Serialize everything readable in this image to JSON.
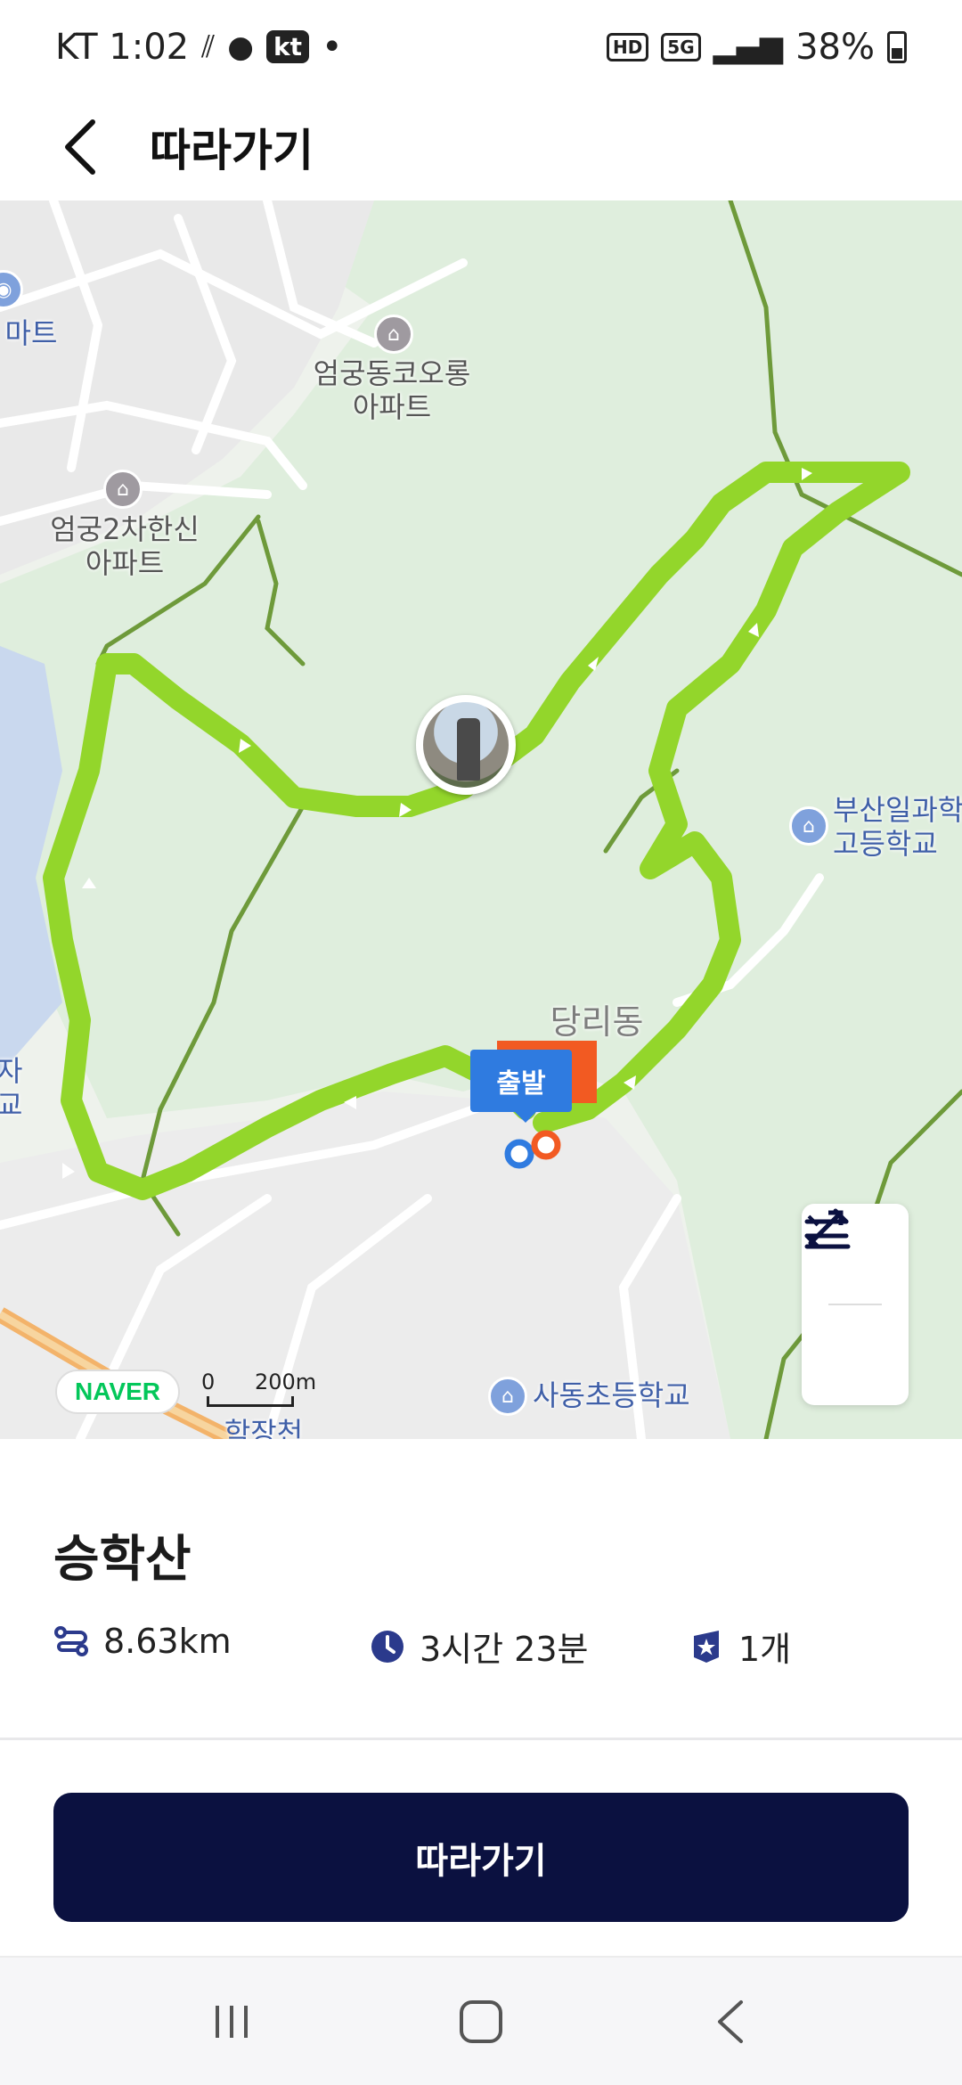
{
  "status_bar": {
    "carrier_time": "KT 1:02",
    "carrier_badge": "kt",
    "dot": "•",
    "hd_badge": "HD",
    "network_badge": "5G",
    "battery_text": "38%"
  },
  "header": {
    "title": "따라가기",
    "back_icon": "chevron-left-icon"
  },
  "map": {
    "labels": {
      "apt1": "엄궁동코오롱\n아파트",
      "apt2": "엄궁2차한신\n아파트",
      "mart": "마트",
      "school_high": "부산일과학\n고등학교",
      "dong": "당리동",
      "school_elem": "사동초등학교",
      "left_edge_1": "자",
      "left_edge_2": "교",
      "bottom_stream": "학장천"
    },
    "start_tag": "출발",
    "naver_logo": "NAVER",
    "scale": {
      "zero": "0",
      "distance": "200m"
    },
    "controls": [
      "slope-icon",
      "swap-icon"
    ],
    "colors": {
      "route": "#93d62b",
      "start": "#2f7be0",
      "end": "#f25a22",
      "trail": "#6e9a3a"
    }
  },
  "sheet": {
    "trail_name": "승학산",
    "distance": "8.63km",
    "duration": "3시간 23분",
    "badge_count": "1개",
    "follow_button": "따라가기"
  },
  "navbar": [
    "recent-apps-icon",
    "home-icon",
    "back-icon"
  ]
}
